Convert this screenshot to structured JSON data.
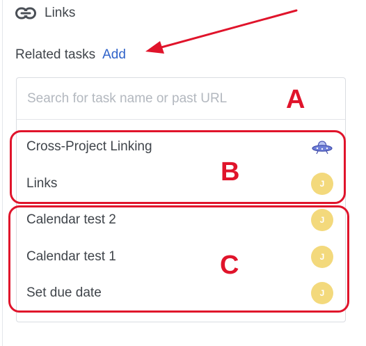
{
  "links_section": {
    "title": "Links",
    "icon": "link-icon"
  },
  "related_tasks": {
    "label": "Related tasks",
    "add_label": "Add"
  },
  "search": {
    "placeholder": "Search for task name or past URL",
    "value": ""
  },
  "tasks": [
    {
      "name": "Cross-Project Linking",
      "right": "ufo-icon"
    },
    {
      "name": "Links",
      "avatar": "J"
    },
    {
      "name": "Calendar test 2",
      "avatar": "J"
    },
    {
      "name": "Calendar test 1",
      "avatar": "J"
    },
    {
      "name": "Set due date",
      "avatar": "J"
    }
  ],
  "annotations": {
    "letters": [
      "A",
      "B",
      "C"
    ],
    "color": "#e0142b"
  },
  "colors": {
    "link": "#2f62c9",
    "avatar": "#f3d97c",
    "annotation": "#e0142b"
  }
}
